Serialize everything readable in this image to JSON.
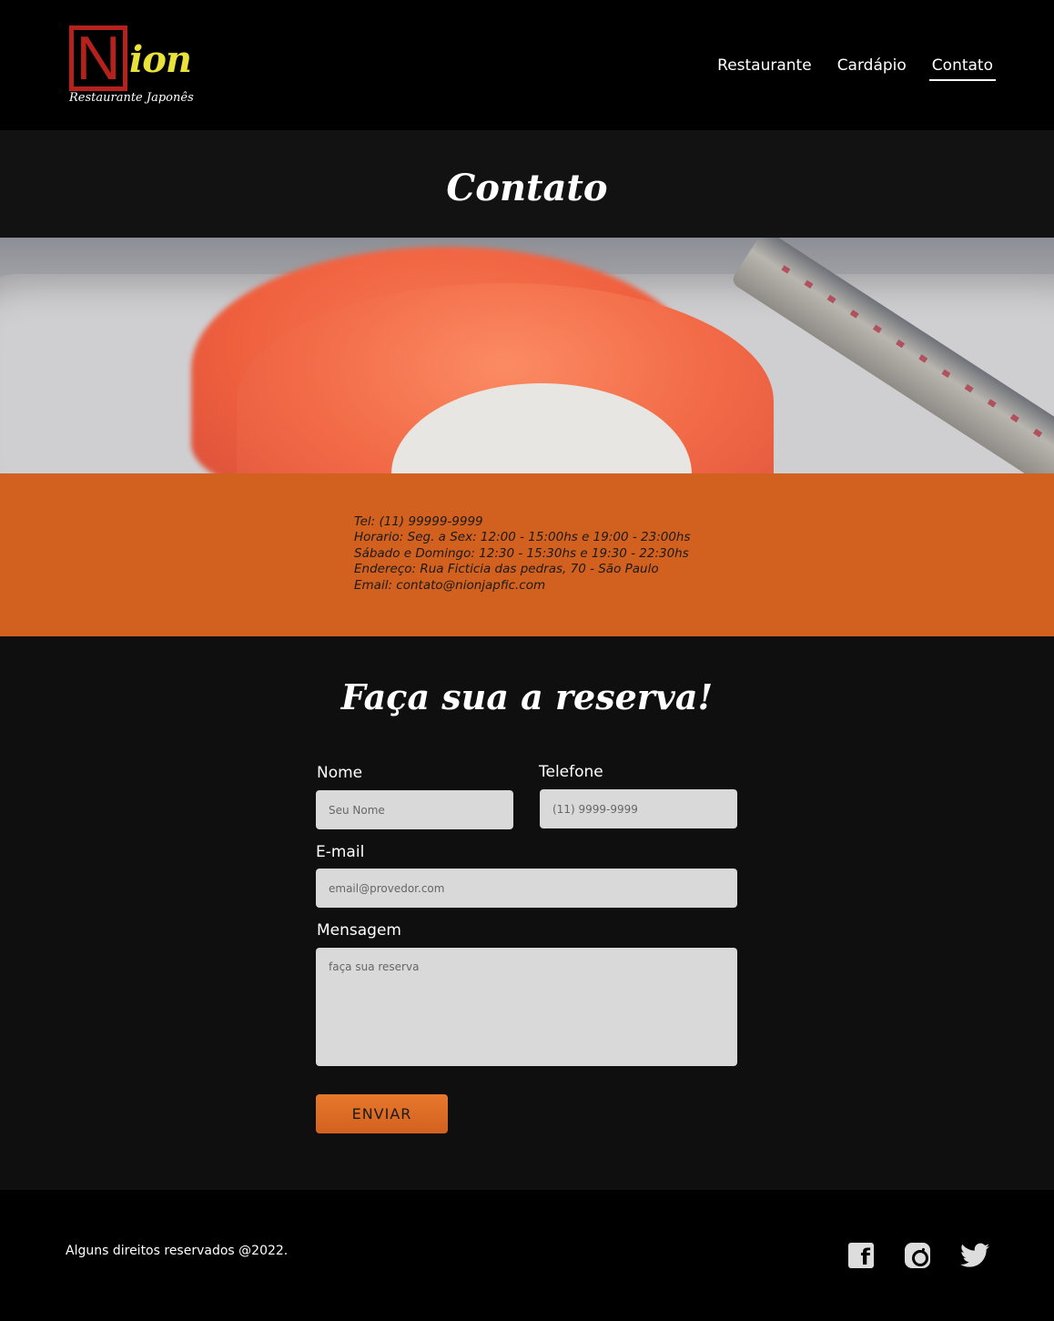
{
  "header": {
    "logo_letter": "N",
    "logo_text": "ion",
    "logo_subtitle": "Restaurante Japonês",
    "nav": [
      {
        "label": "Restaurante"
      },
      {
        "label": "Cardápio"
      },
      {
        "label": "Contato",
        "active": true
      }
    ]
  },
  "title_band": {
    "title": "Contato"
  },
  "info": {
    "lines": [
      "Tel: (11) 99999-9999",
      "Horario: Seg. a Sex: 12:00 - 15:00hs e 19:00 - 23:00hs",
      "Sábado e Domingo: 12:30 - 15:30hs e 19:30 - 22:30hs",
      "Endereço: Rua Ficticia das pedras, 70 - São Paulo",
      "Email: contato@nionjapfic.com"
    ]
  },
  "form": {
    "title": "Faça sua a reserva!",
    "name_label": "Nome",
    "name_placeholder": "Seu Nome",
    "phone_label": "Telefone",
    "phone_placeholder": "(11) 9999-9999",
    "email_label": "E-mail",
    "email_placeholder": "email@provedor.com",
    "message_label": "Mensagem",
    "message_placeholder": "faça sua reserva",
    "submit_label": "ENVIAR"
  },
  "footer": {
    "copyright": "Alguns direitos reservados @2022.",
    "social": [
      "facebook-icon",
      "instagram-icon",
      "twitter-icon"
    ]
  },
  "colors": {
    "accent": "#d2611f",
    "logo_red": "#b5211b",
    "logo_yellow": "#e8e23a",
    "background": "#0f0f0f",
    "field": "#d9d9d9"
  }
}
